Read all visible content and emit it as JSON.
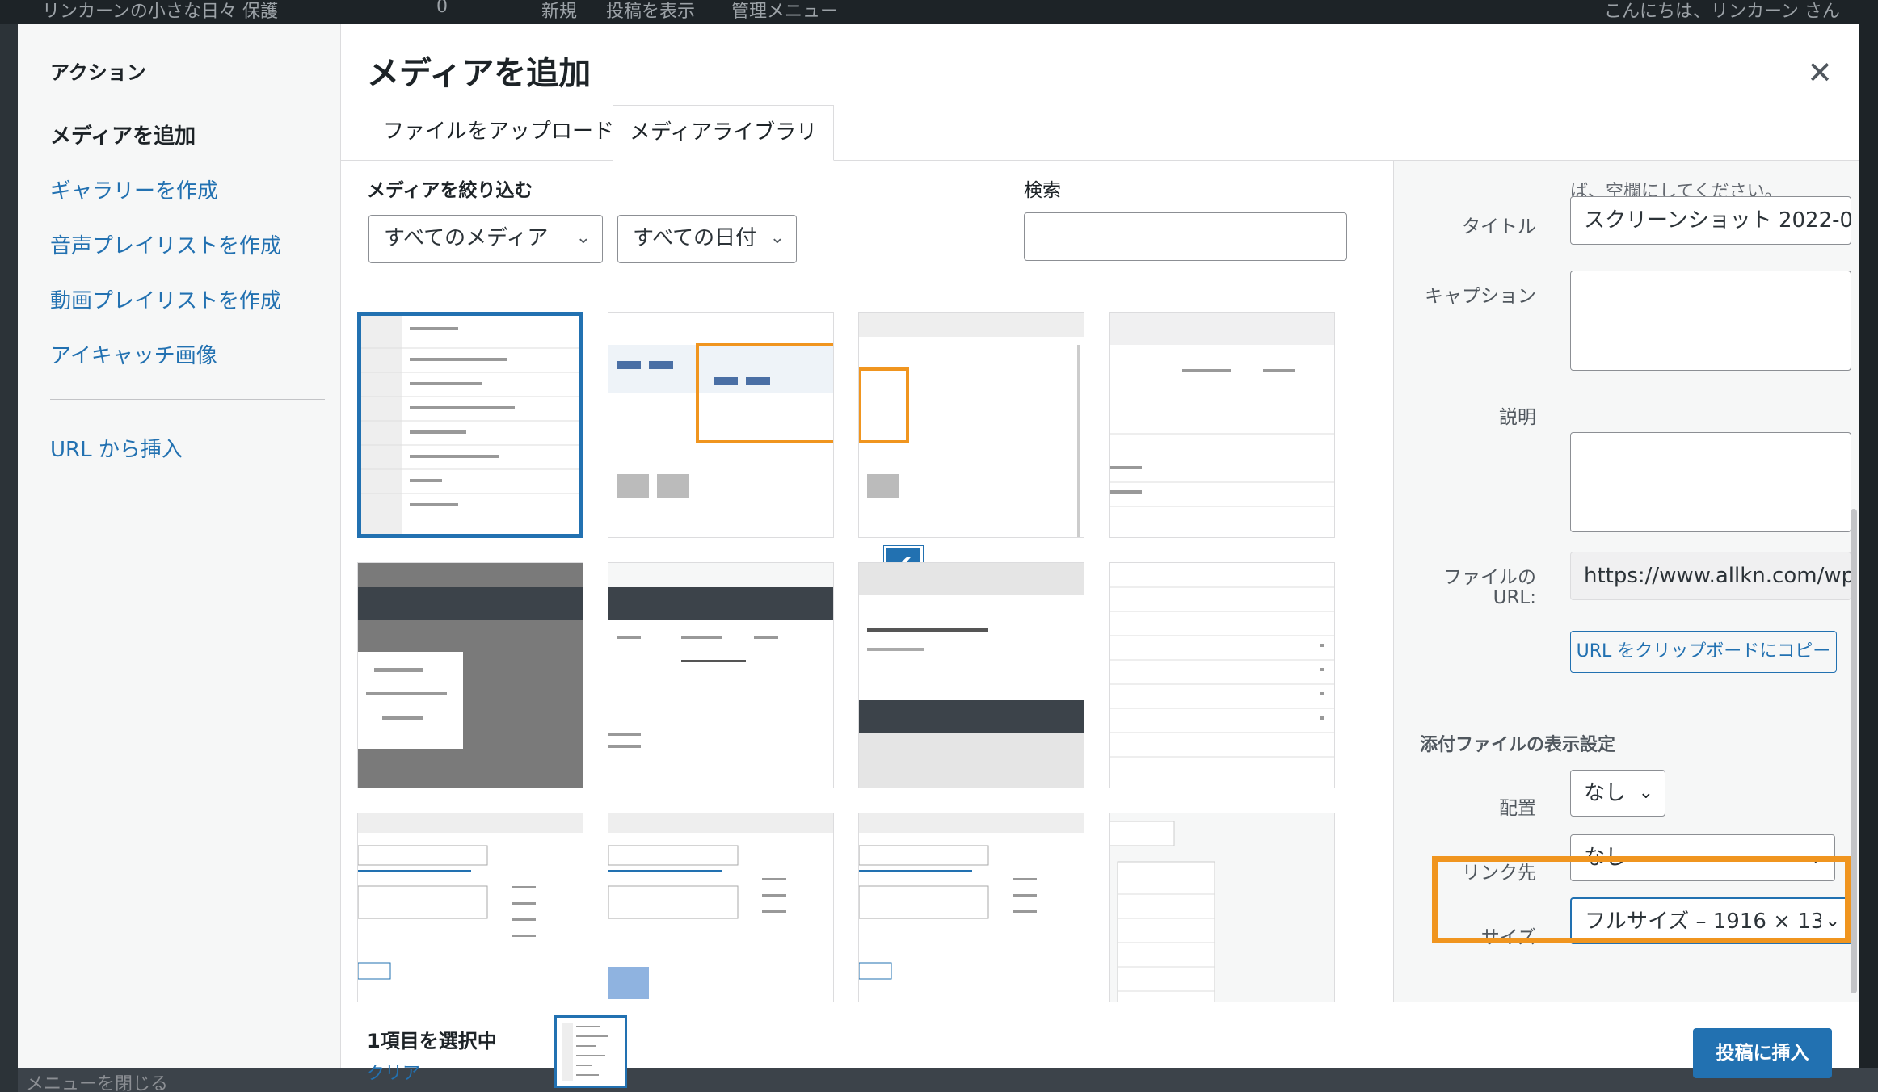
{
  "admin_bar": {
    "site_name": "リンカーンの小さな日々",
    "protect": "保護",
    "comments_count": "0",
    "new": "新規",
    "view_post": "投稿を表示",
    "admin_menu": "管理メニュー",
    "greeting": "こんにちは、リンカーン さん"
  },
  "background": {
    "collapse_menu": "メニューを閉じる"
  },
  "modal": {
    "title": "メディアを追加",
    "close_icon": "close-icon",
    "menu": {
      "heading": "アクション",
      "items": [
        {
          "label": "メディアを追加",
          "active": true
        },
        {
          "label": "ギャラリーを作成"
        },
        {
          "label": "音声プレイリストを作成"
        },
        {
          "label": "動画プレイリストを作成"
        },
        {
          "label": "アイキャッチ画像"
        }
      ],
      "url_insert": "URL から挿入"
    },
    "tabs": [
      {
        "label": "ファイルをアップロード"
      },
      {
        "label": "メディアライブラリ",
        "active": true
      }
    ],
    "filters": {
      "label": "メディアを絞り込む",
      "media_type": "すべてのメディア",
      "date": "すべての日付",
      "search_label": "検索",
      "search_value": ""
    },
    "thumbnail_count": 12,
    "details": {
      "note": "ば、空欄にしてください。",
      "title_label": "タイトル",
      "title_value": "スクリーンショット 2022-0",
      "caption_label": "キャプション",
      "caption_value": "",
      "description_label": "説明",
      "description_value": "",
      "file_url_label_1": "ファイルの",
      "file_url_label_2": "URL:",
      "file_url_value": "https://www.allkn.com/wp",
      "copy_button": "URL をクリップボードにコピー",
      "display_settings": "添付ファイルの表示設定",
      "align_label": "配置",
      "align_value": "なし",
      "link_label": "リンク先",
      "link_value": "なし",
      "size_label": "サイズ",
      "size_value": "フルサイズ – 1916 × 13"
    },
    "toolbar": {
      "selected_count": "1項目を選択中",
      "clear": "クリア",
      "insert_button": "投稿に挿入"
    }
  },
  "colors": {
    "accent": "#2271b1",
    "highlight": "#f0951f",
    "sidebar_bg": "#f6f7f7"
  }
}
